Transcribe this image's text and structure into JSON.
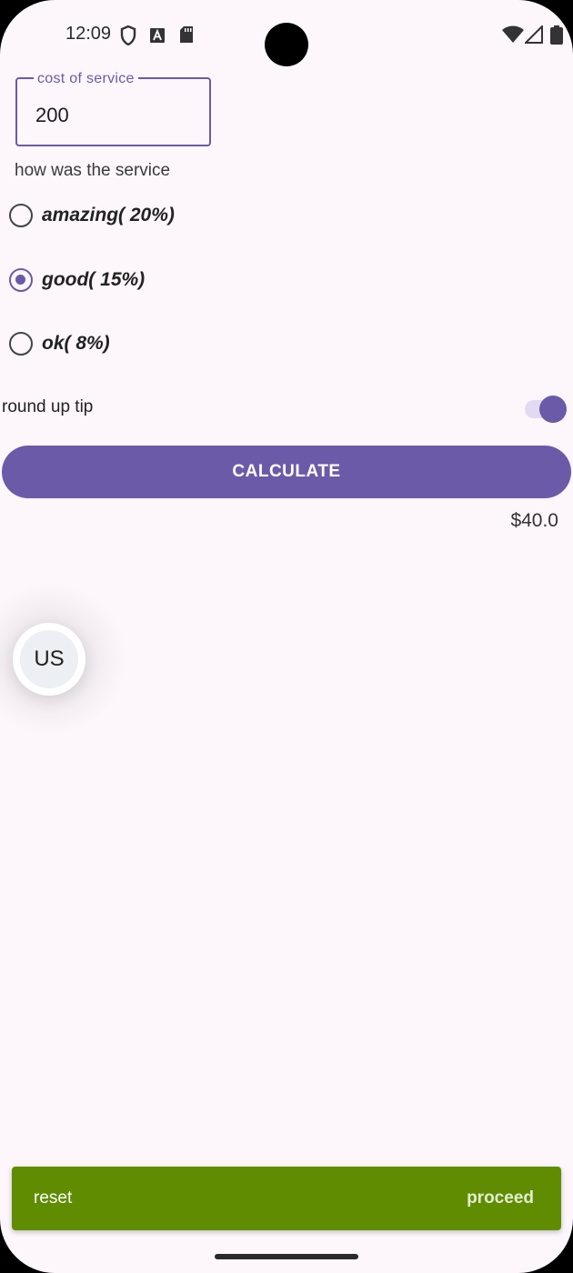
{
  "status_bar": {
    "time": "12:09",
    "icons": [
      "shield-icon",
      "a-box-icon",
      "sd-card-icon",
      "wifi-icon",
      "signal-icon",
      "battery-icon"
    ]
  },
  "form": {
    "cost_label": "cost of service",
    "cost_value": "200",
    "question": "how was the service",
    "options": [
      {
        "label": "amazing( 20%)",
        "checked": false
      },
      {
        "label": "good( 15%)",
        "checked": true
      },
      {
        "label": "ok( 8%)",
        "checked": false
      }
    ],
    "round_up_label": "round up tip",
    "round_up_on": true,
    "calculate_label": "CALCULATE",
    "result": "$40.0"
  },
  "floating_bubble": {
    "text": "US"
  },
  "bottom_bar": {
    "reset_label": "reset",
    "proceed_label": "proceed"
  },
  "colors": {
    "accent": "#6b5aa8",
    "background": "#fdf7fc",
    "bottom_bar": "#5f8c00"
  }
}
